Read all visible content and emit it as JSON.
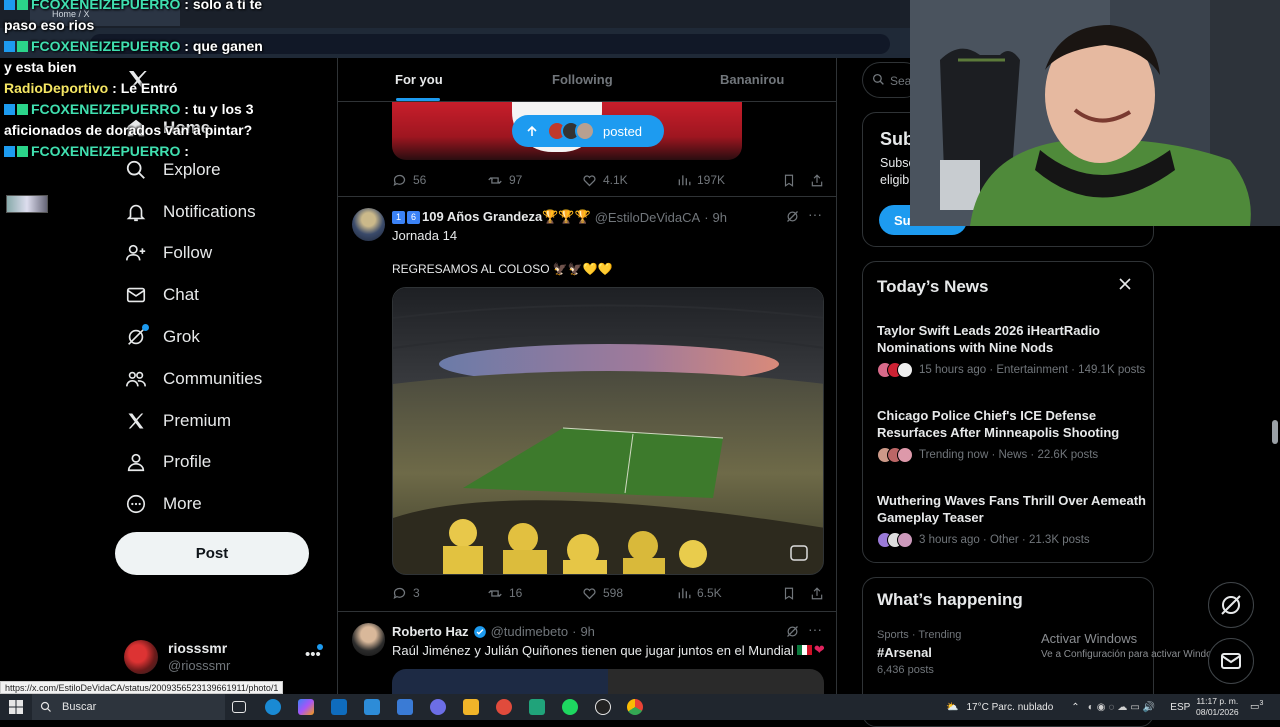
{
  "browser": {
    "tab_title": "Home / X",
    "status_url": "https://x.com/EstiloDeVidaCA/status/2009356523139661911/photo/1"
  },
  "chat_overlay": {
    "messages": [
      {
        "user": "FCOXENEIZEPUERRO",
        "text": "solo a ti te paso eso rios"
      },
      {
        "user": "FCOXENEIZEPUERRO",
        "text": "que ganen y esta bien"
      },
      {
        "user": "RadioDeportivo",
        "text": "Le Entró"
      },
      {
        "user": "FCOXENEIZEPUERRO",
        "text": "tu y los 3 aficionados de dorados van a pintar?"
      },
      {
        "user": "FCOXENEIZEPUERRO",
        "text": ""
      }
    ]
  },
  "sidebar": {
    "items": [
      {
        "label": "Home",
        "icon": "home-icon"
      },
      {
        "label": "Explore",
        "icon": "search-icon"
      },
      {
        "label": "Notifications",
        "icon": "bell-icon"
      },
      {
        "label": "Follow",
        "icon": "person-add-icon"
      },
      {
        "label": "Chat",
        "icon": "mail-icon"
      },
      {
        "label": "Grok",
        "icon": "grok-icon"
      },
      {
        "label": "Communities",
        "icon": "communities-icon"
      },
      {
        "label": "Premium",
        "icon": "x-logo-icon"
      },
      {
        "label": "Profile",
        "icon": "person-icon"
      },
      {
        "label": "More",
        "icon": "more-circle-icon"
      }
    ],
    "post_button": "Post",
    "account": {
      "name": "riosssmr",
      "handle": "@riosssmr"
    }
  },
  "feed": {
    "tabs": [
      "For you",
      "Following",
      "Bananirou"
    ],
    "active_tab": 0,
    "posted_pill": "posted",
    "posts": [
      {
        "stats": {
          "replies": "56",
          "reposts": "97",
          "likes": "4.1K",
          "views": "197K"
        }
      },
      {
        "author_badges": [
          "1",
          "6"
        ],
        "author_name": "109 Años Grandeza🏆🏆🏆",
        "handle": "@EstiloDeVidaCA",
        "time": "9h",
        "text_line1": "Jornada 14",
        "text_line2": "REGRESAMOS AL COLOSO 🦅🦅💛💛",
        "stats": {
          "replies": "3",
          "reposts": "16",
          "likes": "598",
          "views": "6.5K"
        }
      },
      {
        "author_name": "Roberto Haz",
        "verified": true,
        "handle": "@tudimebeto",
        "time": "9h",
        "text": "Raúl Jiménez y Julián Quiñones tienen que jugar juntos en el Mundial"
      }
    ]
  },
  "right": {
    "search_placeholder": "Sea",
    "subscribe": {
      "title": "Sub",
      "desc_line1": "Subsc",
      "desc_line2": "eligib",
      "button": "Su"
    },
    "todays_news": {
      "title": "Today’s News",
      "items": [
        {
          "title": "Taylor Swift Leads 2026 iHeartRadio Nominations with Nine Nods",
          "meta": "15 hours ago · Entertainment · 149.1K posts"
        },
        {
          "title": "Chicago Police Chief's ICE Defense Resurfaces After Minneapolis Shooting",
          "meta": "Trending now · News · 22.6K posts"
        },
        {
          "title": "Wuthering Waves Fans Thrill Over Aemeath Gameplay Teaser",
          "meta": "3 hours ago · Other · 21.3K posts"
        }
      ]
    },
    "whats_happening": {
      "title": "What’s happening",
      "category": "Sports · Trending",
      "tag": "#Arsenal",
      "count": "6,436 posts"
    }
  },
  "watermark": {
    "line1": "Activar Windows",
    "line2": "Ve a Configuración para activar Windows."
  },
  "taskbar": {
    "search": "Buscar",
    "weather": "17°C  Parc. nublado",
    "lang": "ESP",
    "time": "11:17 p. m.",
    "date": "08/01/2026",
    "notif_count": "3"
  },
  "colors": {
    "accent": "#1d9bf0",
    "bg": "#000000",
    "muted": "#71767b",
    "chat_user": "#40e0b0"
  }
}
